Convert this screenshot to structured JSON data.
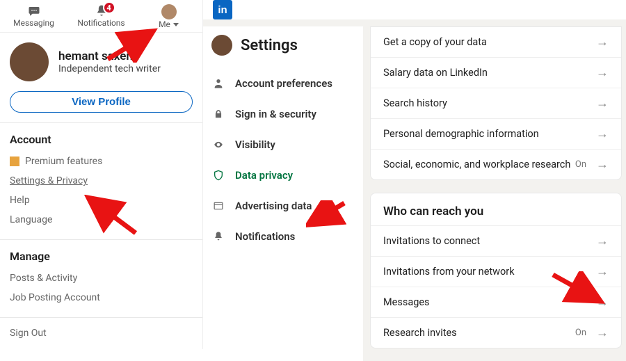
{
  "topnav": {
    "messaging": "Messaging",
    "notifications": "Notifications",
    "notif_count": "4",
    "me": "Me"
  },
  "user": {
    "name": "hemant saxena",
    "headline": "Independent tech writer",
    "view_btn": "View Profile"
  },
  "account": {
    "title": "Account",
    "premium": "Premium features",
    "settings": "Settings & Privacy",
    "help": "Help",
    "language": "Language"
  },
  "manage": {
    "title": "Manage",
    "posts": "Posts & Activity",
    "jobs": "Job Posting Account"
  },
  "signout": "Sign Out",
  "logo": "in",
  "settings_nav": {
    "title": "Settings",
    "items": [
      {
        "label": "Account preferences"
      },
      {
        "label": "Sign in & security"
      },
      {
        "label": "Visibility"
      },
      {
        "label": "Data privacy"
      },
      {
        "label": "Advertising data"
      },
      {
        "label": "Notifications"
      }
    ]
  },
  "section1": {
    "rows": [
      {
        "label": "Get a copy of your data",
        "state": ""
      },
      {
        "label": "Salary data on LinkedIn",
        "state": ""
      },
      {
        "label": "Search history",
        "state": ""
      },
      {
        "label": "Personal demographic information",
        "state": ""
      },
      {
        "label": "Social, economic, and workplace research",
        "state": "On"
      }
    ]
  },
  "section2": {
    "title": "Who can reach you",
    "rows": [
      {
        "label": "Invitations to connect",
        "state": ""
      },
      {
        "label": "Invitations from your network",
        "state": ""
      },
      {
        "label": "Messages",
        "state": ""
      },
      {
        "label": "Research invites",
        "state": "On"
      }
    ]
  }
}
